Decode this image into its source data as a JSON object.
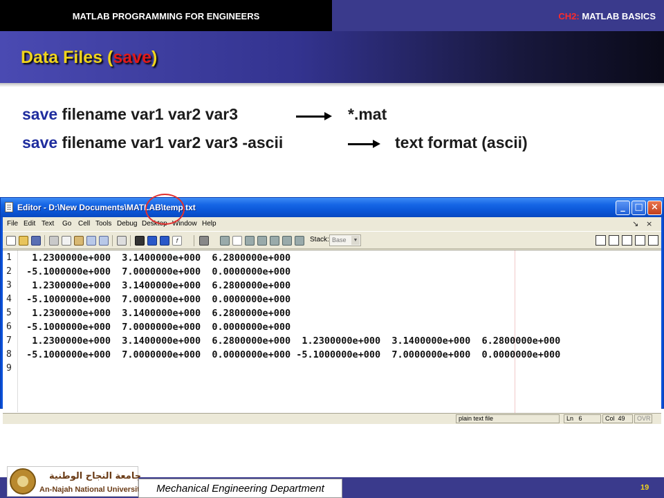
{
  "header": {
    "course": "MATLAB PROGRAMMING FOR ENGINEERS",
    "chapter_code": "CH2:",
    "chapter_name": " MATLAB BASICS"
  },
  "slide": {
    "title_prefix": "Data Files (",
    "title_keyword": "save",
    "title_suffix": ")"
  },
  "lines": [
    {
      "keyword": "save",
      "rest": " filename var1 var2 var3",
      "result": "*.mat"
    },
    {
      "keyword": "save",
      "rest": " filename var1 var2 var3  -ascii",
      "result": "text format (ascii)"
    }
  ],
  "editor": {
    "title": "Editor - D:\\New Documents\\MATLAB\\temp.txt",
    "menu": [
      "File",
      "Edit",
      "Text",
      "Go",
      "Cell",
      "Tools",
      "Debug",
      "Desktop",
      "Window",
      "Help"
    ],
    "stack_label": "Stack:",
    "stack_value": "Base",
    "line_numbers": [
      "1",
      "2",
      "3",
      "4",
      "5",
      "6",
      "7",
      "8",
      "9"
    ],
    "code_lines": [
      "  1.2300000e+000  3.1400000e+000  6.2800000e+000",
      " -5.1000000e+000  7.0000000e+000  0.0000000e+000",
      "  1.2300000e+000  3.1400000e+000  6.2800000e+000",
      " -5.1000000e+000  7.0000000e+000  0.0000000e+000",
      "  1.2300000e+000  3.1400000e+000  6.2800000e+000",
      " -5.1000000e+000  7.0000000e+000  0.0000000e+000",
      "  1.2300000e+000  3.1400000e+000  6.2800000e+000  1.2300000e+000  3.1400000e+000  6.2800000e+000",
      " -5.1000000e+000  7.0000000e+000  0.0000000e+000 -5.1000000e+000  7.0000000e+000  0.0000000e+000",
      ""
    ],
    "status": {
      "file_type": "plain text file",
      "ln_label": "Ln",
      "ln_value": "6",
      "col_label": "Col",
      "col_value": "49",
      "ovr": "OVR"
    }
  },
  "footer": {
    "department": "Mechanical Engineering Department",
    "page_number": "19",
    "university_ar": "جامعة النجاح الوطنية",
    "university_en": "An-Najah National University"
  }
}
